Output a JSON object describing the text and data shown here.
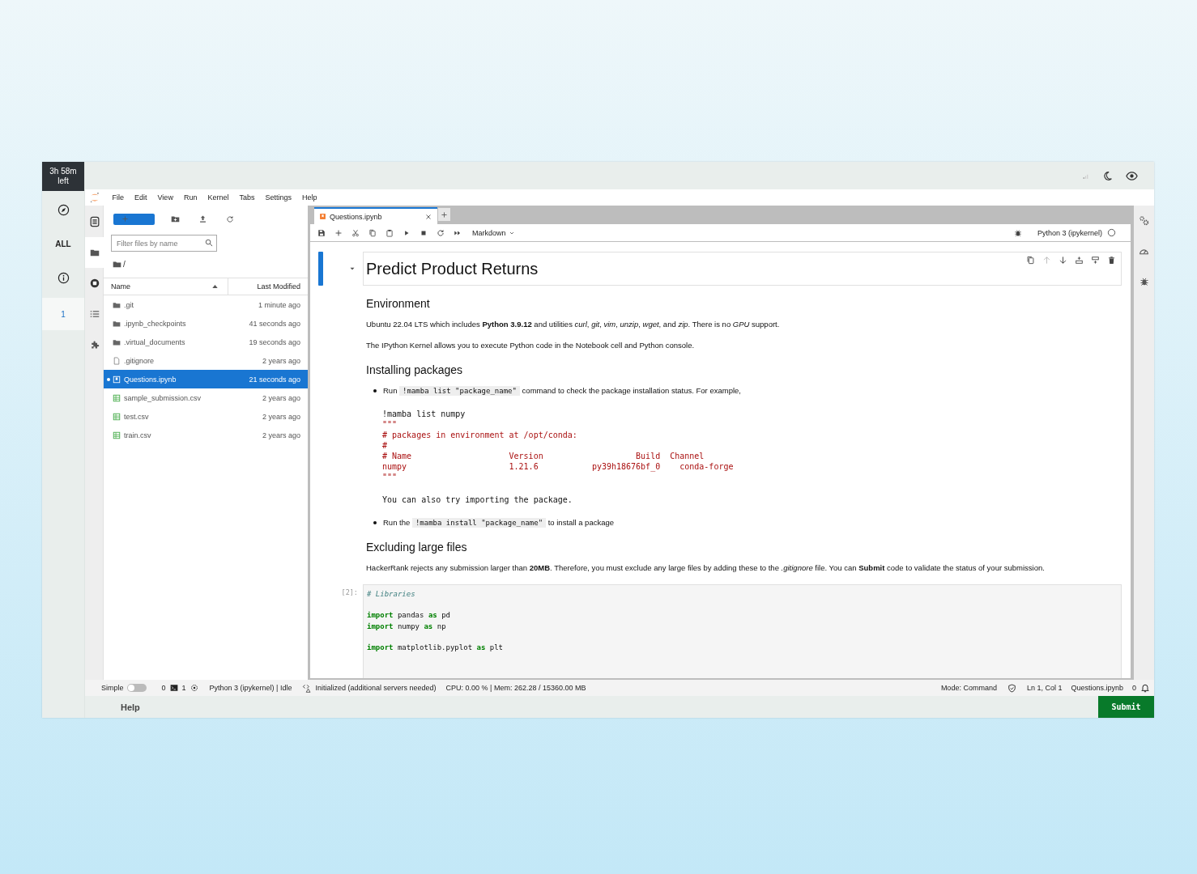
{
  "timer": "3h 58m left",
  "rail": [
    {
      "kind": "compass",
      "selected": false
    },
    {
      "kind": "label",
      "label": "ALL",
      "selected": false
    },
    {
      "kind": "info",
      "selected": false
    },
    {
      "kind": "label",
      "label": "1",
      "selected": true
    }
  ],
  "menu": [
    "File",
    "Edit",
    "View",
    "Run",
    "Kernel",
    "Tabs",
    "Settings",
    "Help"
  ],
  "activity_bar": [
    {
      "kind": "document",
      "selected": false
    },
    {
      "kind": "folder",
      "selected": true
    },
    {
      "kind": "running",
      "selected": false
    },
    {
      "kind": "list",
      "selected": false
    },
    {
      "kind": "puzzle",
      "selected": false
    }
  ],
  "file_browser": {
    "filter": {
      "placeholder": "Filter files by name"
    },
    "path": "/",
    "columns": [
      "Name",
      "Last Modified"
    ],
    "files": [
      {
        "name": ".git",
        "kind": "folder",
        "modified": "1 minute ago",
        "selected": false,
        "running": false
      },
      {
        "name": ".ipynb_checkpoints",
        "kind": "folder",
        "modified": "41 seconds ago",
        "selected": false,
        "running": false
      },
      {
        "name": ".virtual_documents",
        "kind": "folder",
        "modified": "19 seconds ago",
        "selected": false,
        "running": false
      },
      {
        "name": ".gitignore",
        "kind": "file",
        "modified": "2 years ago",
        "selected": false,
        "running": false
      },
      {
        "name": "Questions.ipynb",
        "kind": "notebook",
        "modified": "21 seconds ago",
        "selected": true,
        "running": true
      },
      {
        "name": "sample_submission.csv",
        "kind": "table",
        "modified": "2 years ago",
        "selected": false,
        "running": false
      },
      {
        "name": "test.csv",
        "kind": "table",
        "modified": "2 years ago",
        "selected": false,
        "running": false
      },
      {
        "name": "train.csv",
        "kind": "table",
        "modified": "2 years ago",
        "selected": false,
        "running": false
      }
    ]
  },
  "notebook": {
    "tab": "Questions.ipynb",
    "cell_type": "Markdown",
    "kernel": "Python 3 (ipykernel)",
    "title": "Predict Product Returns",
    "blocks": [
      {
        "kind": "h2",
        "text": "Environment"
      },
      {
        "kind": "p",
        "text": "Ubuntu 22.04 LTS which includes **Python 3.9.12** and utilities *curl*, *git*, *vim*, *unzip*, *wget*, and *zip*. There is no *GPU* support."
      },
      {
        "kind": "p",
        "text": "The IPython Kernel allows you to execute Python code in the Notebook cell and Python console."
      },
      {
        "kind": "h2",
        "text": "Installing packages"
      },
      {
        "kind": "li",
        "runs": [
          {
            "kind": "text",
            "text": "Run "
          },
          {
            "kind": "code",
            "text": "!mamba list \"package_name\""
          },
          {
            "kind": "text",
            "text": " command to check the package installation status. For example,"
          }
        ]
      },
      {
        "kind": "pre",
        "segments": [
          {
            "kind": "command",
            "text": "!mamba list numpy"
          },
          {
            "kind": "output",
            "text": "\"\"\"\n# packages in environment at /opt/conda:\n#\n# Name                    Version                   Build  Channel\nnumpy                     1.21.6           py39h18676bf_0    conda-forge\n\"\"\""
          },
          {
            "kind": "note",
            "text": "You can also try importing the package."
          }
        ]
      },
      {
        "kind": "li",
        "runs": [
          {
            "kind": "text",
            "text": "Run the "
          },
          {
            "kind": "code",
            "text": "!mamba install \"package_name\""
          },
          {
            "kind": "text",
            "text": " to install a package"
          }
        ]
      },
      {
        "kind": "h2",
        "text": "Excluding large files"
      },
      {
        "kind": "p",
        "text": "HackerRank rejects any submission larger than **20MB**. Therefore, you must exclude any large files by adding these to the *.gitignore* file. You can **Submit** code to validate the status of your submission."
      }
    ],
    "code_cell": {
      "prompt": "[2]:",
      "groups": [
        [
          [
            {
              "kind": "comment",
              "text": "# Libraries"
            }
          ]
        ],
        [
          [
            {
              "kind": "keyword",
              "text": "import"
            },
            {
              "kind": "name",
              "text": " pandas "
            },
            {
              "kind": "keyword",
              "text": "as"
            },
            {
              "kind": "name",
              "text": " pd"
            }
          ],
          [
            {
              "kind": "keyword",
              "text": "import"
            },
            {
              "kind": "name",
              "text": " numpy "
            },
            {
              "kind": "keyword",
              "text": "as"
            },
            {
              "kind": "name",
              "text": " np"
            }
          ]
        ],
        [
          [
            {
              "kind": "keyword",
              "text": "import"
            },
            {
              "kind": "name",
              "text": " matplotlib.pyplot "
            },
            {
              "kind": "keyword",
              "text": "as"
            },
            {
              "kind": "name",
              "text": " plt"
            }
          ]
        ]
      ]
    }
  },
  "status_bar": {
    "simple_label": "Simple",
    "simple_mode": false,
    "terminals": "0",
    "kernels": "1",
    "kernel_status": "Python 3 (ipykernel) | Idle",
    "lsp": "Initialized (additional servers needed)",
    "resources": "CPU: 0.00 % | Mem: 262.28 / 15360.00 MB",
    "mode": "Mode: Command",
    "position": "Ln 1, Col 1",
    "file": "Questions.ipynb",
    "notifications": "0"
  },
  "footer": {
    "help": "Help",
    "submit": "Submit"
  }
}
